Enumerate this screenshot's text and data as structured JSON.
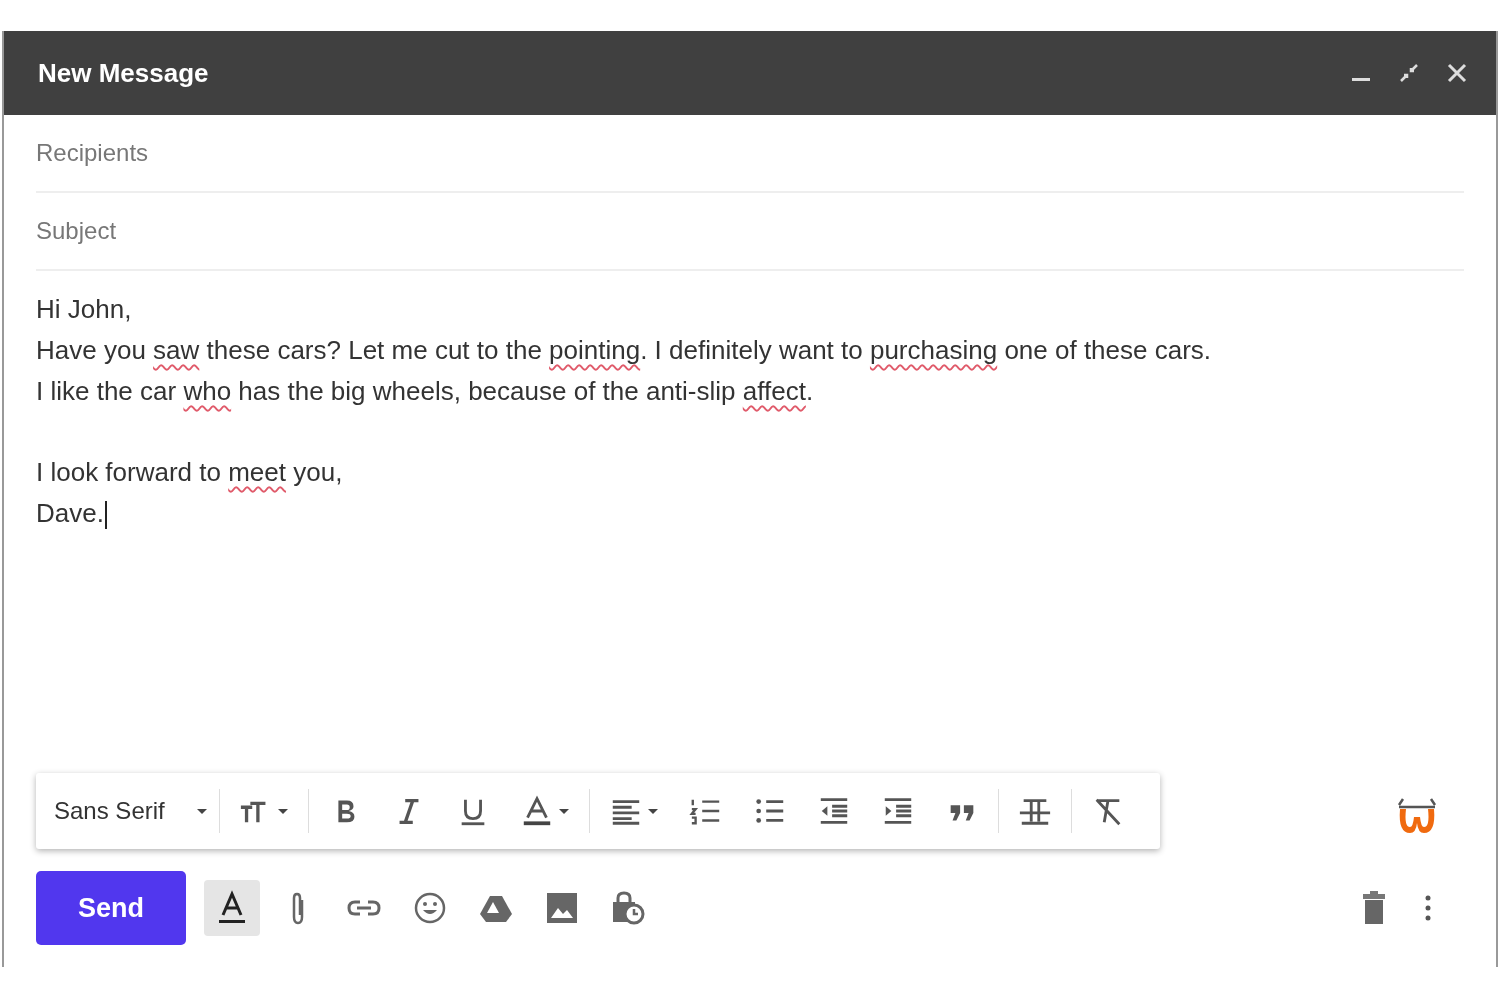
{
  "window": {
    "title": "New Message"
  },
  "fields": {
    "recipients": {
      "placeholder": "Recipients"
    },
    "subject": {
      "placeholder": "Subject"
    }
  },
  "body": {
    "paragraphs": [
      {
        "lines": [
          [
            {
              "text": "Hi John,",
              "flagged": false
            }
          ],
          [
            {
              "text": "Have you ",
              "flagged": false
            },
            {
              "text": "saw",
              "flagged": true
            },
            {
              "text": " these cars? Let me cut to the ",
              "flagged": false
            },
            {
              "text": "pointing",
              "flagged": true
            },
            {
              "text": ". I definitely want to ",
              "flagged": false
            },
            {
              "text": "purchasing",
              "flagged": true
            },
            {
              "text": " one of these cars.",
              "flagged": false
            }
          ],
          [
            {
              "text": "I like the car ",
              "flagged": false
            },
            {
              "text": "who",
              "flagged": true
            },
            {
              "text": " has the big wheels, because of the anti-slip ",
              "flagged": false
            },
            {
              "text": "affect",
              "flagged": true
            },
            {
              "text": ".",
              "flagged": false
            }
          ]
        ]
      },
      {
        "lines": [
          [
            {
              "text": "I look forward to ",
              "flagged": false
            },
            {
              "text": "meet",
              "flagged": true
            },
            {
              "text": " you,",
              "flagged": false
            }
          ],
          [
            {
              "text": "Dave.",
              "flagged": false
            }
          ]
        ]
      }
    ]
  },
  "format_toolbar": {
    "font": "Sans Serif"
  },
  "actions": {
    "send": "Send",
    "formatting_toggle": {
      "selected": true
    }
  }
}
